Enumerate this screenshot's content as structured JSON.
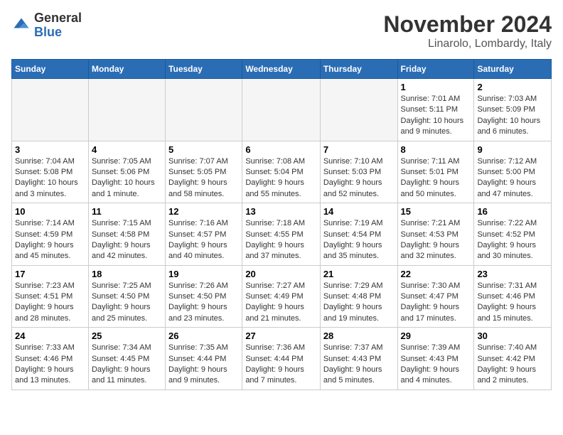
{
  "header": {
    "logo_general": "General",
    "logo_blue": "Blue",
    "month": "November 2024",
    "location": "Linarolo, Lombardy, Italy"
  },
  "weekdays": [
    "Sunday",
    "Monday",
    "Tuesday",
    "Wednesday",
    "Thursday",
    "Friday",
    "Saturday"
  ],
  "weeks": [
    [
      {
        "day": "",
        "info": ""
      },
      {
        "day": "",
        "info": ""
      },
      {
        "day": "",
        "info": ""
      },
      {
        "day": "",
        "info": ""
      },
      {
        "day": "",
        "info": ""
      },
      {
        "day": "1",
        "info": "Sunrise: 7:01 AM\nSunset: 5:11 PM\nDaylight: 10 hours and 9 minutes."
      },
      {
        "day": "2",
        "info": "Sunrise: 7:03 AM\nSunset: 5:09 PM\nDaylight: 10 hours and 6 minutes."
      }
    ],
    [
      {
        "day": "3",
        "info": "Sunrise: 7:04 AM\nSunset: 5:08 PM\nDaylight: 10 hours and 3 minutes."
      },
      {
        "day": "4",
        "info": "Sunrise: 7:05 AM\nSunset: 5:06 PM\nDaylight: 10 hours and 1 minute."
      },
      {
        "day": "5",
        "info": "Sunrise: 7:07 AM\nSunset: 5:05 PM\nDaylight: 9 hours and 58 minutes."
      },
      {
        "day": "6",
        "info": "Sunrise: 7:08 AM\nSunset: 5:04 PM\nDaylight: 9 hours and 55 minutes."
      },
      {
        "day": "7",
        "info": "Sunrise: 7:10 AM\nSunset: 5:03 PM\nDaylight: 9 hours and 52 minutes."
      },
      {
        "day": "8",
        "info": "Sunrise: 7:11 AM\nSunset: 5:01 PM\nDaylight: 9 hours and 50 minutes."
      },
      {
        "day": "9",
        "info": "Sunrise: 7:12 AM\nSunset: 5:00 PM\nDaylight: 9 hours and 47 minutes."
      }
    ],
    [
      {
        "day": "10",
        "info": "Sunrise: 7:14 AM\nSunset: 4:59 PM\nDaylight: 9 hours and 45 minutes."
      },
      {
        "day": "11",
        "info": "Sunrise: 7:15 AM\nSunset: 4:58 PM\nDaylight: 9 hours and 42 minutes."
      },
      {
        "day": "12",
        "info": "Sunrise: 7:16 AM\nSunset: 4:57 PM\nDaylight: 9 hours and 40 minutes."
      },
      {
        "day": "13",
        "info": "Sunrise: 7:18 AM\nSunset: 4:55 PM\nDaylight: 9 hours and 37 minutes."
      },
      {
        "day": "14",
        "info": "Sunrise: 7:19 AM\nSunset: 4:54 PM\nDaylight: 9 hours and 35 minutes."
      },
      {
        "day": "15",
        "info": "Sunrise: 7:21 AM\nSunset: 4:53 PM\nDaylight: 9 hours and 32 minutes."
      },
      {
        "day": "16",
        "info": "Sunrise: 7:22 AM\nSunset: 4:52 PM\nDaylight: 9 hours and 30 minutes."
      }
    ],
    [
      {
        "day": "17",
        "info": "Sunrise: 7:23 AM\nSunset: 4:51 PM\nDaylight: 9 hours and 28 minutes."
      },
      {
        "day": "18",
        "info": "Sunrise: 7:25 AM\nSunset: 4:50 PM\nDaylight: 9 hours and 25 minutes."
      },
      {
        "day": "19",
        "info": "Sunrise: 7:26 AM\nSunset: 4:50 PM\nDaylight: 9 hours and 23 minutes."
      },
      {
        "day": "20",
        "info": "Sunrise: 7:27 AM\nSunset: 4:49 PM\nDaylight: 9 hours and 21 minutes."
      },
      {
        "day": "21",
        "info": "Sunrise: 7:29 AM\nSunset: 4:48 PM\nDaylight: 9 hours and 19 minutes."
      },
      {
        "day": "22",
        "info": "Sunrise: 7:30 AM\nSunset: 4:47 PM\nDaylight: 9 hours and 17 minutes."
      },
      {
        "day": "23",
        "info": "Sunrise: 7:31 AM\nSunset: 4:46 PM\nDaylight: 9 hours and 15 minutes."
      }
    ],
    [
      {
        "day": "24",
        "info": "Sunrise: 7:33 AM\nSunset: 4:46 PM\nDaylight: 9 hours and 13 minutes."
      },
      {
        "day": "25",
        "info": "Sunrise: 7:34 AM\nSunset: 4:45 PM\nDaylight: 9 hours and 11 minutes."
      },
      {
        "day": "26",
        "info": "Sunrise: 7:35 AM\nSunset: 4:44 PM\nDaylight: 9 hours and 9 minutes."
      },
      {
        "day": "27",
        "info": "Sunrise: 7:36 AM\nSunset: 4:44 PM\nDaylight: 9 hours and 7 minutes."
      },
      {
        "day": "28",
        "info": "Sunrise: 7:37 AM\nSunset: 4:43 PM\nDaylight: 9 hours and 5 minutes."
      },
      {
        "day": "29",
        "info": "Sunrise: 7:39 AM\nSunset: 4:43 PM\nDaylight: 9 hours and 4 minutes."
      },
      {
        "day": "30",
        "info": "Sunrise: 7:40 AM\nSunset: 4:42 PM\nDaylight: 9 hours and 2 minutes."
      }
    ]
  ]
}
